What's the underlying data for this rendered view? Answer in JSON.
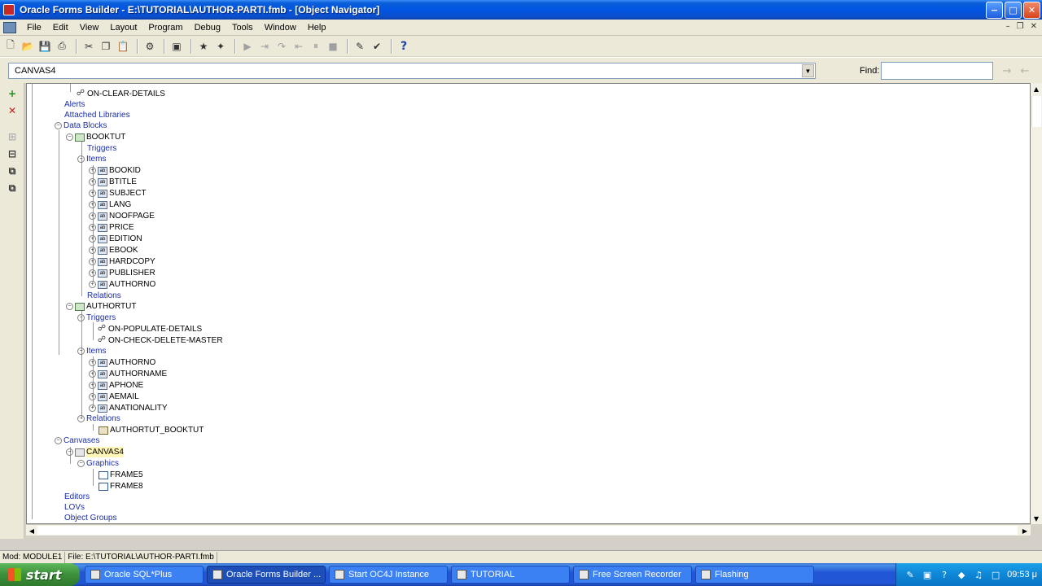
{
  "window": {
    "title": "Oracle Forms Builder - E:\\TUTORIAL\\AUTHOR-PARTI.fmb - [Object Navigator]",
    "minimize": "−",
    "maximize": "□",
    "close": "✕"
  },
  "menu": [
    "File",
    "Edit",
    "View",
    "Layout",
    "Program",
    "Debug",
    "Tools",
    "Window",
    "Help"
  ],
  "mdi_controls": {
    "minimize": "–",
    "restore": "❐",
    "close": "✕"
  },
  "navigator": {
    "current_node": "CANVAS4",
    "find_label": "Find:",
    "find_value": ""
  },
  "tree": [
    "ON-CLEAR-DETAILS",
    "Alerts",
    "Attached Libraries",
    "Data Blocks",
    "BOOKTUT",
    "Triggers",
    "Items",
    "BOOKID",
    "BTITLE",
    "SUBJECT",
    "LANG",
    "NOOFPAGE",
    "PRICE",
    "EDITION",
    "EBOOK",
    "HARDCOPY",
    "PUBLISHER",
    "AUTHORNO",
    "Relations",
    "AUTHORTUT",
    "Triggers",
    "ON-POPULATE-DETAILS",
    "ON-CHECK-DELETE-MASTER",
    "Items",
    "AUTHORNO",
    "AUTHORNAME",
    "APHONE",
    "AEMAIL",
    "ANATIONALITY",
    "Relations",
    "AUTHORTUT_BOOKTUT",
    "Canvases",
    "CANVAS4",
    "Graphics",
    "FRAME5",
    "FRAME8",
    "Editors",
    "LOVs",
    "Object Groups"
  ],
  "status": {
    "mod": "Mod: MODULE1",
    "file": "File: E:\\TUTORIAL\\AUTHOR-PARTI.fmb"
  },
  "taskbar": {
    "start": "start",
    "tasks": [
      "Oracle SQL*Plus",
      "Oracle Forms Builder ...",
      "Start OC4J Instance",
      "TUTORIAL",
      "Free Screen Recorder",
      "Flashing"
    ],
    "clock": "09:53 μ"
  },
  "colors": {
    "titlebar": "#0054e3",
    "taskbar": "#2157d7",
    "start_button": "#3c8f3a",
    "link_text": "#1b2fa8",
    "selected_highlight": "#fff6b8"
  }
}
